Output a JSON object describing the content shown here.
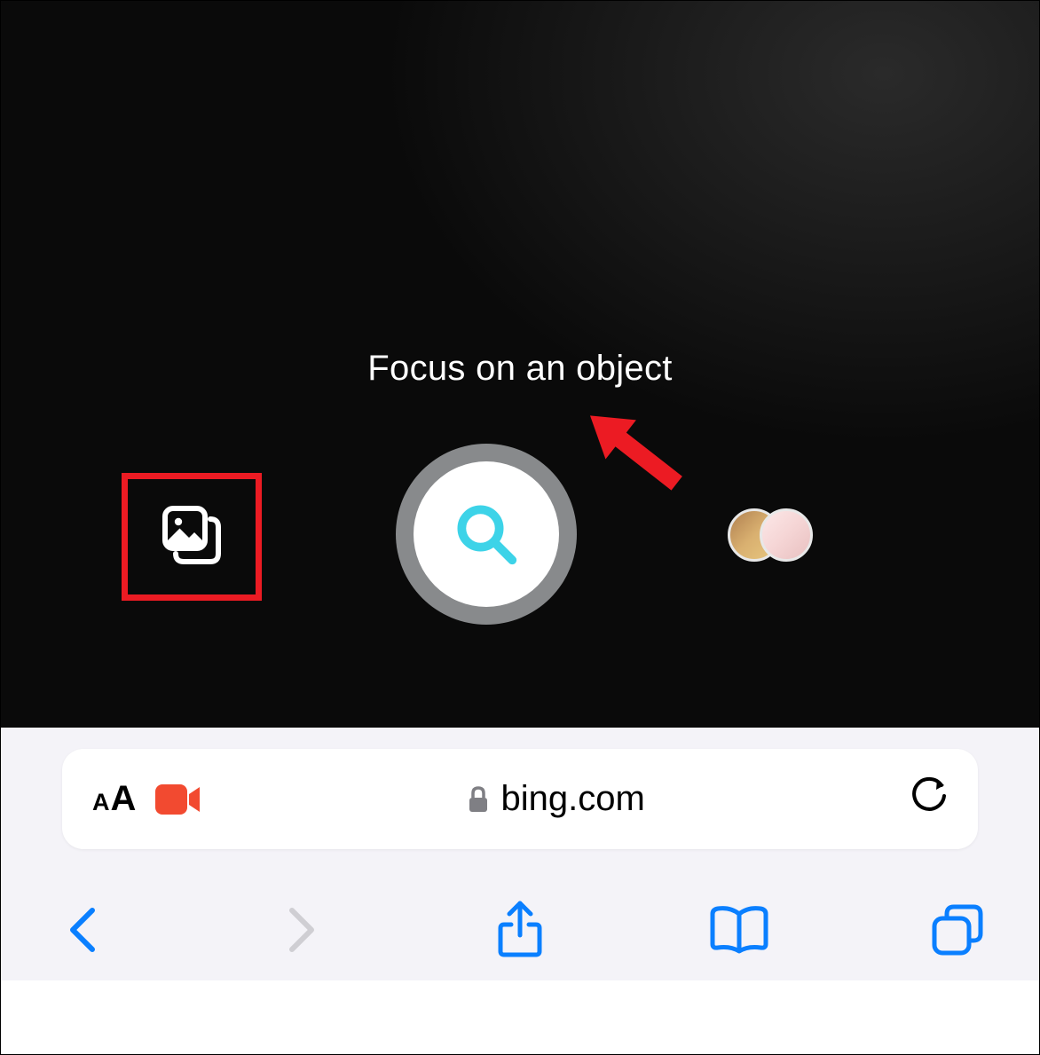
{
  "camera": {
    "hint": "Focus on an object",
    "icons": {
      "gallery": "gallery-icon",
      "search": "search-icon"
    },
    "annotations": {
      "highlight_box": "red",
      "arrow": "red"
    }
  },
  "addressBar": {
    "aa_label_small": "A",
    "aa_label_large": "A",
    "url": "bing.com",
    "icons": {
      "recorder": "video-camera-icon",
      "lock": "lock-icon",
      "reload": "reload-icon"
    }
  },
  "toolbar": {
    "back": "back-icon",
    "forward": "forward-icon",
    "share": "share-icon",
    "bookmarks": "book-icon",
    "tabs": "tabs-icon"
  },
  "colors": {
    "accent_blue": "#0a7fff",
    "search_cyan": "#3dd3e8",
    "recorder_red": "#f24a30",
    "annotation_red": "#ec1b23",
    "chrome_bg": "#f4f3f8"
  }
}
